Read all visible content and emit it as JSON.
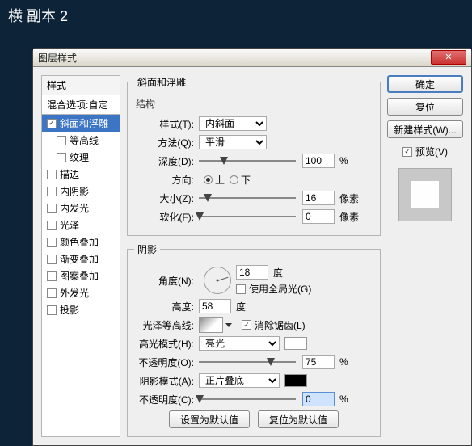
{
  "doc_title": "横 副本 2",
  "dialog_title": "图层样式",
  "styles": {
    "header": "样式",
    "blend": "混合选项:自定",
    "items": [
      {
        "label": "斜面和浮雕",
        "checked": true,
        "selected": true,
        "indent": false
      },
      {
        "label": "等高线",
        "checked": false,
        "selected": false,
        "indent": true
      },
      {
        "label": "纹理",
        "checked": false,
        "selected": false,
        "indent": true
      },
      {
        "label": "描边",
        "checked": false,
        "selected": false,
        "indent": false
      },
      {
        "label": "内阴影",
        "checked": false,
        "selected": false,
        "indent": false
      },
      {
        "label": "内发光",
        "checked": false,
        "selected": false,
        "indent": false
      },
      {
        "label": "光泽",
        "checked": false,
        "selected": false,
        "indent": false
      },
      {
        "label": "颜色叠加",
        "checked": false,
        "selected": false,
        "indent": false
      },
      {
        "label": "渐变叠加",
        "checked": false,
        "selected": false,
        "indent": false
      },
      {
        "label": "图案叠加",
        "checked": false,
        "selected": false,
        "indent": false
      },
      {
        "label": "外发光",
        "checked": false,
        "selected": false,
        "indent": false
      },
      {
        "label": "投影",
        "checked": false,
        "selected": false,
        "indent": false
      }
    ]
  },
  "bevel": {
    "legend": "斜面和浮雕",
    "structure_label": "结构",
    "style_label": "样式(T):",
    "style_value": "内斜面",
    "technique_label": "方法(Q):",
    "technique_value": "平滑",
    "depth_label": "深度(D):",
    "depth_value": "100",
    "depth_unit": "%",
    "direction_label": "方向:",
    "dir_up": "上",
    "dir_down": "下",
    "size_label": "大小(Z):",
    "size_value": "16",
    "size_unit": "像素",
    "soften_label": "软化(F):",
    "soften_value": "0",
    "soften_unit": "像素"
  },
  "shading": {
    "legend": "阴影",
    "angle_label": "角度(N):",
    "angle_value": "18",
    "angle_unit": "度",
    "global_label": "使用全局光(G)",
    "altitude_label": "高度:",
    "altitude_value": "58",
    "altitude_unit": "度",
    "contour_label": "光泽等高线:",
    "antialias_label": "消除锯齿(L)",
    "hl_mode_label": "高光模式(H):",
    "hl_mode_value": "亮光",
    "hl_opacity_label": "不透明度(O):",
    "hl_opacity_value": "75",
    "hl_opacity_unit": "%",
    "sh_mode_label": "阴影模式(A):",
    "sh_mode_value": "正片叠底",
    "sh_opacity_label": "不透明度(C):",
    "sh_opacity_value": "0",
    "sh_opacity_unit": "%",
    "make_default": "设置为默认值",
    "reset_default": "复位为默认值"
  },
  "right": {
    "ok": "确定",
    "cancel": "复位",
    "new_style": "新建样式(W)...",
    "preview": "预览(V)"
  }
}
